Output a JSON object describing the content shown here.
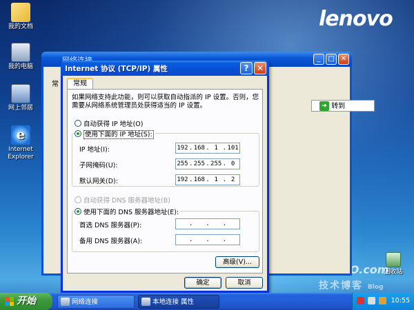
{
  "desktop": {
    "brand": "lenovo",
    "icons": [
      {
        "label": "我的文档",
        "icon": "my-documents-icon"
      },
      {
        "label": "我的电脑",
        "icon": "my-computer-icon"
      },
      {
        "label": "网上邻居",
        "icon": "network-places-icon"
      },
      {
        "label": "Internet Explorer",
        "icon": "internet-explorer-icon"
      },
      {
        "label": "回收站",
        "icon": "recycle-bin-icon"
      }
    ],
    "watermark": "51CTO.com",
    "watermark_sub": "技术博客",
    "watermark_small": "Blog"
  },
  "background_window": {
    "title": "网络连接",
    "tab": "常",
    "go_label": "转到"
  },
  "dialog": {
    "title": "Internet 协议 (TCP/IP) 属性",
    "help_label": "?",
    "close_label": "✕",
    "tab": "常规",
    "intro": "如果网络支持此功能，则可以获取自动指派的 IP 设置。否则，您需要从网络系统管理员处获得适当的 IP 设置。",
    "auto_ip": "自动获得 IP 地址(O)",
    "manual_ip": "使用下面的 IP 地址(S):",
    "ip_label": "IP 地址(I):",
    "mask_label": "子网掩码(U):",
    "gateway_label": "默认网关(D):",
    "ip": [
      "192",
      "168",
      "1",
      "101"
    ],
    "mask": [
      "255",
      "255",
      "255",
      "0"
    ],
    "gateway": [
      "192",
      "168",
      "1",
      "2"
    ],
    "auto_dns": "自动获得 DNS 服务器地址(B)",
    "manual_dns": "使用下面的 DNS 服务器地址(E):",
    "dns1_label": "首选 DNS 服务器(P):",
    "dns2_label": "备用 DNS 服务器(A):",
    "dot": ".",
    "advanced_button": "高级(V)...",
    "ok_button": "确定",
    "cancel_button": "取消"
  },
  "taskbar": {
    "start_label": "开始",
    "tasks": [
      "网络连接",
      "本地连接 属性"
    ],
    "clock": "10:55"
  }
}
